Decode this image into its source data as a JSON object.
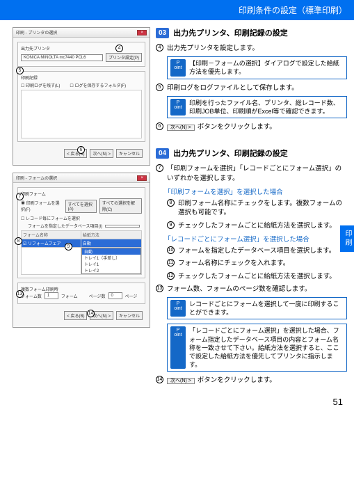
{
  "header": {
    "title": "印刷条件の設定（標準印刷）"
  },
  "side_tab": "印刷",
  "page_number": "51",
  "dialog1": {
    "title": "印刷 - プリンタの選択",
    "group1_label": "出力先プリンタ",
    "printer": "KONICA MINOLTA mc7440 PCL6",
    "printer_prop_btn": "プリンタ設定(P)",
    "group2_label": "印刷記録",
    "chk1": "印刷ログを残す(L)",
    "chk2": "ログを保存するフォルダ(F)",
    "footer_back": "< 戻る(B)",
    "footer_next": "次へ(N) >",
    "footer_cancel": "キャンセル"
  },
  "dialog2": {
    "title": "印刷 - フォームの選択",
    "group1_label": "印刷フォーム",
    "radio1": "印刷フォームを選択(F)",
    "radio2": "すべてを選択(A)",
    "radio3": "すべての選択を解除(C)",
    "chk_rec": "レコード毎にフォームを選択",
    "chk_rec_sub": "フォームを指定したデータベース項目(I)",
    "th1": "フォーム名称",
    "th2": "給紙方法",
    "row1_name": "リフォームフェア",
    "row1_feed": "自動",
    "dd1": "自動",
    "dd2": "トレイ1（手差し）",
    "dd3": "トレイ1",
    "dd4": "トレイ2",
    "group2_label": "複数フォーム印刷時",
    "lbl_form": "フォーム数",
    "val_form": "1",
    "lbl_pages": "フォーム",
    "lbl_pc": "ページ数",
    "val_pc": "0",
    "lbl_pg": "ページ",
    "footer_back": "< 戻る(B)",
    "footer_next": "次へ(N) >",
    "footer_cancel": "キャンセル"
  },
  "circles": {
    "c4": "4",
    "c5": "5",
    "c6": "6",
    "c7": "7",
    "c8": "8",
    "c9": "9",
    "c10": "10",
    "c11": "11",
    "c12": "12",
    "c13": "13",
    "c14": "14"
  },
  "section03": {
    "num": "03",
    "title": "出力先プリンタ、印刷記録の設定",
    "s4": "出力先プリンタを設定します。",
    "p1": "【印刷－フォームの選択】ダイアログで設定した給紙方法を優先します。",
    "s5": "印刷ログをログファイルとして保存します。",
    "p2": "印刷を行ったファイル名、プリンタ、総レコード数、印刷JOB単位、印刷順がExcel等で確認できます。",
    "s6_btn": "次へ(N) >",
    "s6": "ボタンをクリックします。"
  },
  "section04": {
    "num": "04",
    "title": "出力先プリンタ、印刷記録の設定",
    "s7": "「印刷フォームを選択」「レコードごとにフォーム選択」のいずれかを選択します。",
    "sub1": "「印刷フォームを選択」を選択した場合",
    "s8": "印刷フォーム名称にチェックをします。複数フォームの選択も可能です。",
    "s9": "チェックしたフォームごとに給紙方法を選択します。",
    "sub2": "「レコードごとにフォーム選択」を選択した場合",
    "s10": "フォームを指定したデータベース項目を選択します。",
    "s11": "フォーム名称にチェックを入れます。",
    "s12": "チェックしたフォームごとに給紙方法を選択します。",
    "s13": "フォーム数、フォームのページ数を確認します。",
    "p3": "レコードごとにフォームを選択して一度に印刷することができます。",
    "p4": "「レコードごとにフォーム選択」を選択した場合、フォーム指定したデータベース項目の内容とフォーム名称を一致させて下さい。給紙方法を選択すると、ここで設定した給紙方法を優先してプリンタに指示します。",
    "s14_btn": "次へ(N) >",
    "s14": "ボタンをクリックします。"
  },
  "point_label_top": "P",
  "point_label_bot": "oint"
}
